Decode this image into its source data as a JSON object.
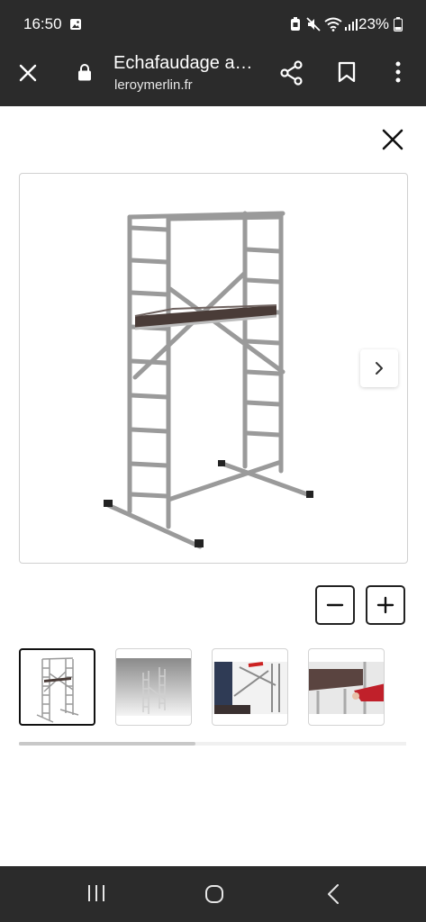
{
  "status": {
    "time": "16:50",
    "battery": "23%"
  },
  "toolbar": {
    "title": "Echafaudage a…",
    "domain": "leroymerlin.fr"
  },
  "gallery": {
    "main_image": "scaffold-tower-image",
    "thumbnails": [
      "scaffold-full-view",
      "scaffold-angled-view",
      "scaffold-assembly-detail",
      "scaffold-platform-detail"
    ],
    "active_thumbnail": 1,
    "scroll_position": 0.45
  },
  "zoom": {
    "out_icon": "minus-icon",
    "in_icon": "plus-icon"
  },
  "colors": {
    "bars": "#2b2b2b",
    "active_border": "#111111",
    "platform": "#4a3c38"
  }
}
